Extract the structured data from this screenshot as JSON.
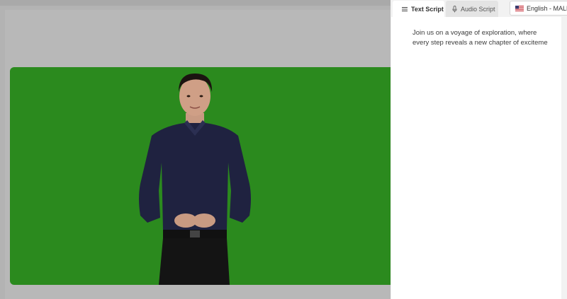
{
  "script_panel": {
    "tabs": [
      {
        "label": "Text Script",
        "icon": "list-icon",
        "active": true
      },
      {
        "label": "Audio Script",
        "icon": "microphone-icon",
        "active": false
      }
    ],
    "voice_select": {
      "value": "English - MALE",
      "flag": "us-flag-icon"
    },
    "script_text": "Join us on a voyage of exploration, where every step reveals a new chapter of exciteme"
  },
  "preview": {
    "background_color": "#2b8a1e"
  }
}
